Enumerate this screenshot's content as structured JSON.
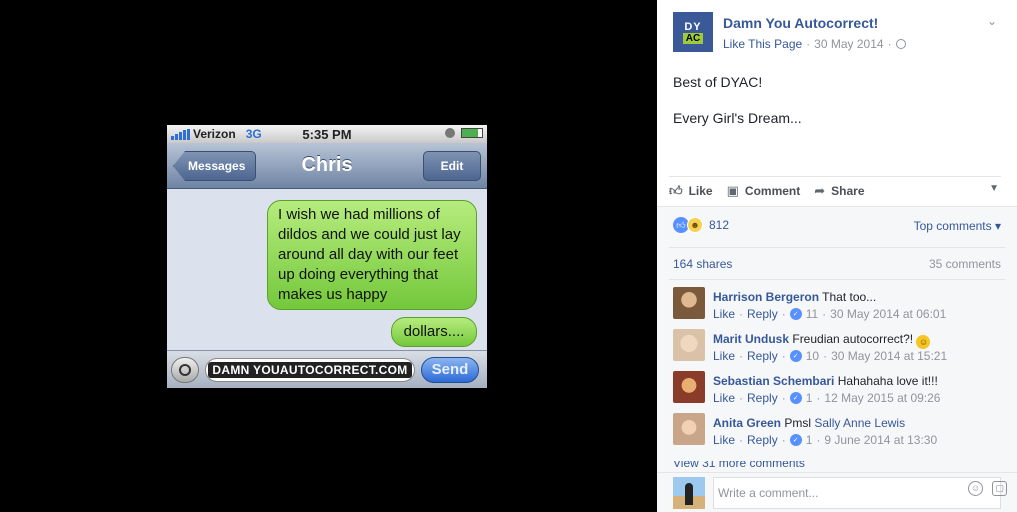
{
  "photo": {
    "status": {
      "carrier": "Verizon",
      "network": "3G",
      "time": "5:35 PM"
    },
    "nav": {
      "back": "Messages",
      "title": "Chris",
      "edit": "Edit"
    },
    "messages": [
      "I wish we had millions of dildos and we could just lay around all day with our feet up doing everything that makes us happy",
      "dollars...."
    ],
    "input": {
      "watermark": "DAMN YOUAUTOCORRECT.COM",
      "send": "Send"
    }
  },
  "post": {
    "page_avatar": {
      "line1": "DY",
      "line2": "AC"
    },
    "page_name": "Damn You Autocorrect!",
    "like_page": "Like This Page",
    "date": "30 May 2014",
    "separator": "·",
    "text1": "Best of DYAC!",
    "text2": "Every Girl's Dream...",
    "actions": {
      "like": "Like",
      "comment": "Comment",
      "share": "Share"
    },
    "reaction_count": "812",
    "top_comments": "Top comments ▾",
    "shares": "164 shares",
    "comments_count": "35 comments"
  },
  "comments": [
    {
      "author": "Harrison Bergeron",
      "text": "That too...",
      "tag": "",
      "like": "Like",
      "reply": "Reply",
      "likes": "11",
      "time": "30 May 2014 at 06:01",
      "avatar_color": "#7a5a3a"
    },
    {
      "author": "Marit Undusk",
      "text": "Freudian autocorrect?!",
      "tag": "",
      "like": "Like",
      "reply": "Reply",
      "likes": "10",
      "time": "30 May 2014 at 15:21",
      "avatar_color": "#d9c2a8"
    },
    {
      "author": "Sebastian Schembari",
      "text": "Hahahaha love it!!!",
      "tag": "",
      "like": "Like",
      "reply": "Reply",
      "likes": "1",
      "time": "12 May 2015 at 09:26",
      "avatar_color": "#8a3b2a"
    },
    {
      "author": "Anita Green",
      "text": "Pmsl",
      "tag": "Sally Anne Lewis",
      "like": "Like",
      "reply": "Reply",
      "likes": "1",
      "time": "9 June 2014 at 13:30",
      "avatar_color": "#c9a58a"
    }
  ],
  "view_more": "View 31 more comments",
  "write_comment": {
    "placeholder": "Write a comment..."
  },
  "icons": {
    "like": "thumbs-up-icon",
    "comment": "speech-bubble-icon",
    "share": "share-arrow-icon",
    "emoji": "smiley-icon",
    "sticker": "sticker-icon"
  }
}
